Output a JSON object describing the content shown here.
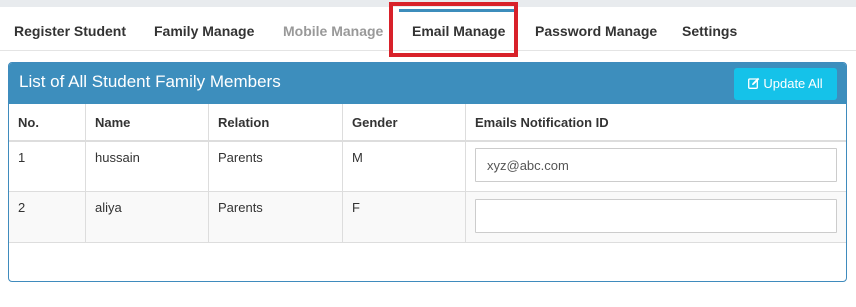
{
  "tabs": [
    {
      "label": "Register Student",
      "state": "normal"
    },
    {
      "label": "Family Manage",
      "state": "normal"
    },
    {
      "label": "Mobile Manage",
      "state": "muted"
    },
    {
      "label": "Email Manage",
      "state": "active"
    },
    {
      "label": "Password Manage",
      "state": "normal"
    },
    {
      "label": "Settings",
      "state": "normal"
    }
  ],
  "panel": {
    "title": "List of All Student Family Members",
    "update_button": {
      "label": "Update All",
      "icon": "pencil-square-icon"
    }
  },
  "table": {
    "columns": [
      "No.",
      "Name",
      "Relation",
      "Gender",
      "Emails Notification ID"
    ],
    "rows": [
      {
        "no": "1",
        "name": "hussain",
        "relation": "Parents",
        "gender": "M",
        "email": "xyz@abc.com"
      },
      {
        "no": "2",
        "name": "aliya",
        "relation": "Parents",
        "gender": "F",
        "email": ""
      }
    ]
  },
  "colors": {
    "header_blue": "#3d8ebd",
    "button_cyan": "#15c2e9",
    "highlight_red": "#d8212a",
    "active_tab_accent": "#3c8dbc"
  }
}
